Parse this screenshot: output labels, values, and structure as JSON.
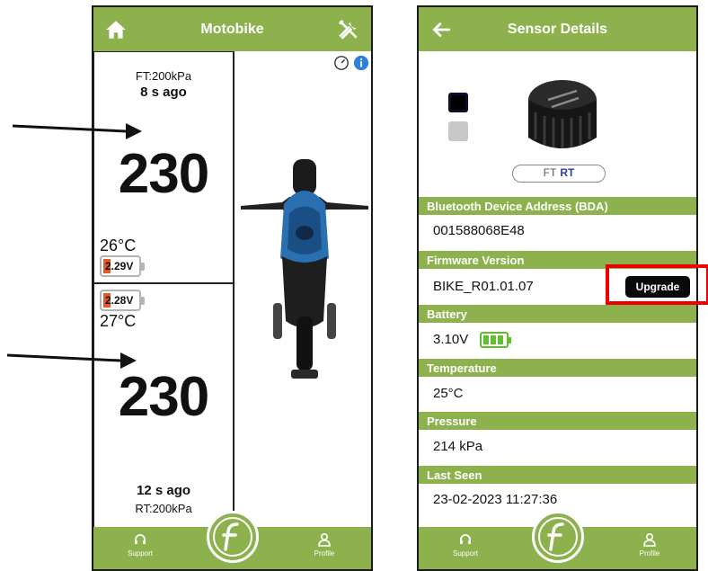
{
  "left_screen": {
    "title": "Motobike",
    "front": {
      "pressure_label": "FT:200kPa",
      "ago": "8 s ago",
      "value": "230",
      "temperature": "26°C",
      "battery": "2.29V"
    },
    "rear": {
      "battery": "2.28V",
      "temperature": "27°C",
      "value": "230",
      "ago": "12 s ago",
      "pressure_label": "RT:200kPa"
    },
    "nav": {
      "support": "Support",
      "profile": "Profile"
    }
  },
  "right_screen": {
    "title": "Sensor Details",
    "toggle": {
      "ft": "FT",
      "rt": "RT"
    },
    "sections": {
      "bda_label": "Bluetooth Device Address (BDA)",
      "bda_value": "001588068E48",
      "firmware_label": "Firmware Version",
      "firmware_value": "BIKE_R01.01.07",
      "upgrade_label": "Upgrade",
      "battery_label": "Battery",
      "battery_value": "3.10V",
      "temp_label": "Temperature",
      "temp_value": "25°C",
      "pressure_label": "Pressure",
      "pressure_value": "214 kPa",
      "last_seen_label": "Last Seen",
      "last_seen_value": "23-02-2023 11:27:36"
    },
    "nav": {
      "support": "Support",
      "profile": "Profile"
    }
  },
  "colors": {
    "header_green": "#8db14d",
    "battery_red": "#e05a2b",
    "annotation_red": "#e00000"
  }
}
